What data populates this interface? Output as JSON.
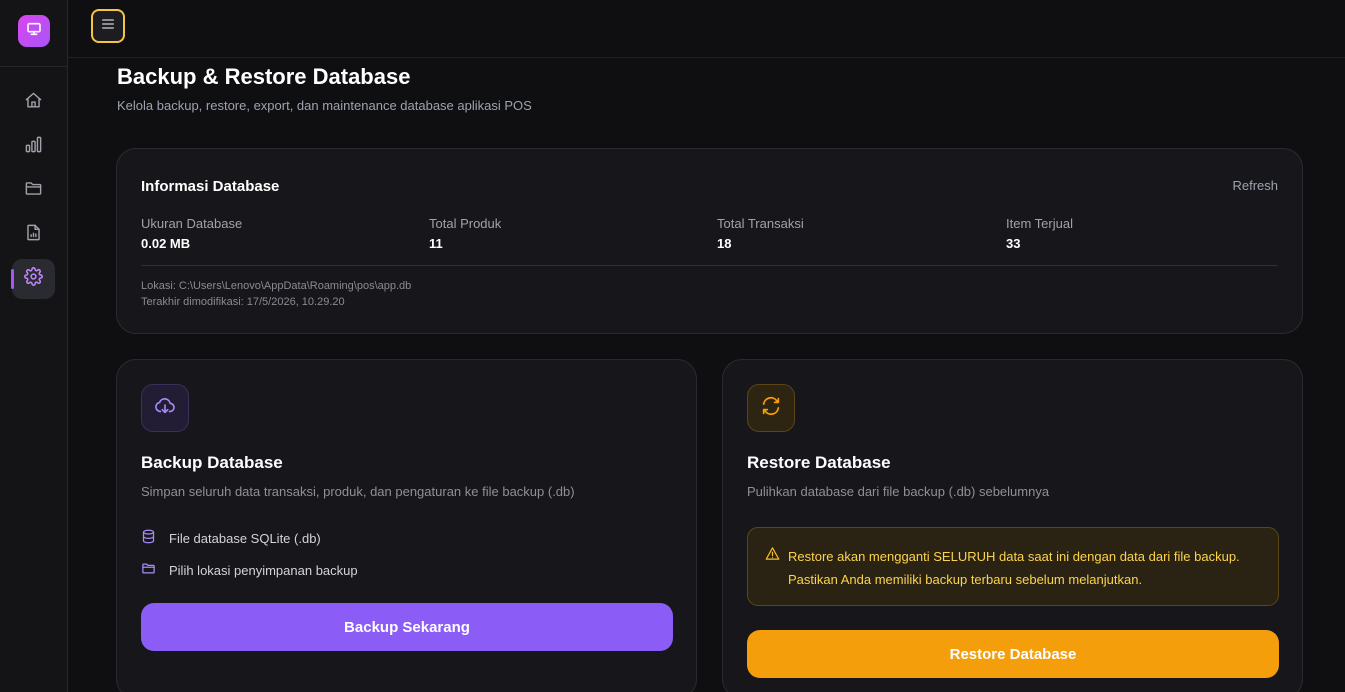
{
  "sidebar": {
    "logo_icon": "monitor-icon",
    "brand_color": "#a855f7",
    "items": [
      {
        "icon": "home-icon",
        "active": false
      },
      {
        "icon": "bar-chart-icon",
        "active": false
      },
      {
        "icon": "folder-icon",
        "active": false
      },
      {
        "icon": "file-report-icon",
        "active": false
      },
      {
        "icon": "settings-icon",
        "active": true
      }
    ]
  },
  "topbar": {
    "menu_icon": "hamburger-menu-icon"
  },
  "header": {
    "title": "Backup & Restore Database",
    "subtitle": "Kelola backup, restore, export, dan maintenance database aplikasi POS"
  },
  "info": {
    "title": "Informasi Database",
    "refresh_label": "Refresh",
    "stats": [
      {
        "label": "Ukuran Database",
        "value": "0.02 MB"
      },
      {
        "label": "Total Produk",
        "value": "11"
      },
      {
        "label": "Total Transaksi",
        "value": "18"
      },
      {
        "label": "Item Terjual",
        "value": "33"
      }
    ],
    "location": "Lokasi: C:\\Users\\Lenovo\\AppData\\Roaming\\pos\\app.db",
    "modified": "Terakhir dimodifikasi: 17/5/2026, 10.29.20"
  },
  "backup": {
    "icon": "cloud-download-icon",
    "title": "Backup Database",
    "description": "Simpan seluruh data transaksi, produk, dan pengaturan ke file backup (.db)",
    "features": [
      {
        "icon": "database-icon",
        "label": "File database SQLite (.db)"
      },
      {
        "icon": "folder-icon",
        "label": "Pilih lokasi penyimpanan backup"
      }
    ],
    "button_label": "Backup Sekarang",
    "button_color": "#8b5cf6"
  },
  "restore": {
    "icon": "refresh-arrows-icon",
    "title": "Restore Database",
    "description": "Pulihkan database dari file backup (.db) sebelumnya",
    "warning_icon": "warning-triangle-icon",
    "warning_text": "Restore akan mengganti SELURUH data saat ini dengan data dari file backup. Pastikan Anda memiliki backup terbaru sebelum melanjutkan.",
    "button_label": "Restore Database",
    "button_color": "#f59e0b"
  }
}
